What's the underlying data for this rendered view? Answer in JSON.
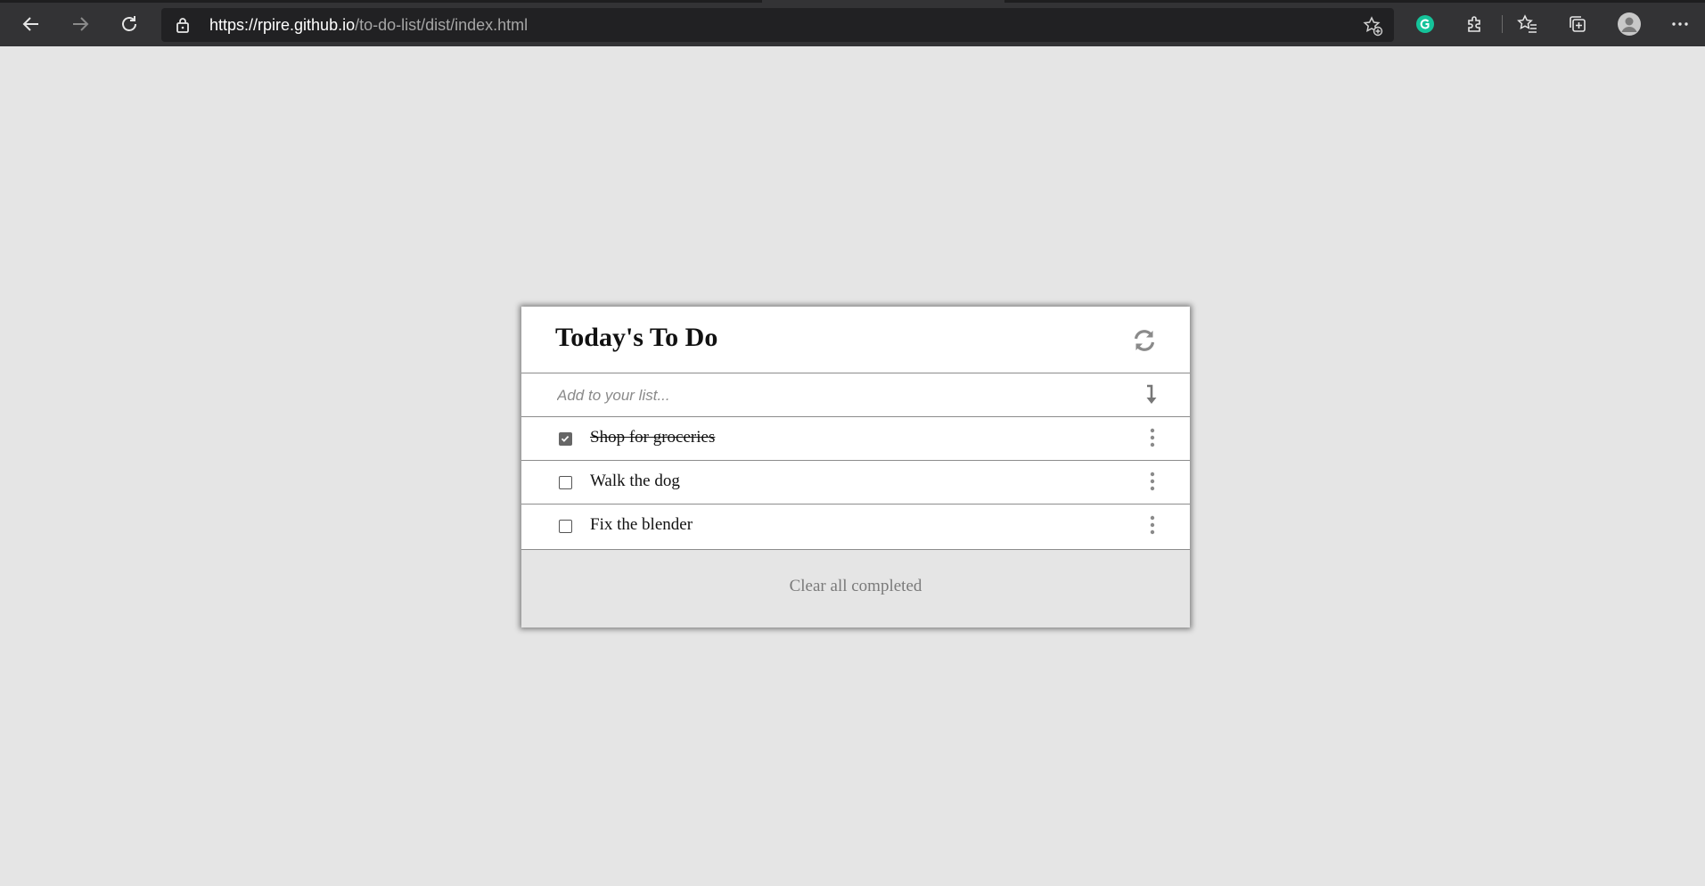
{
  "browser": {
    "url_host": "https://rpire.github.io",
    "url_path": "/to-do-list/dist/index.html"
  },
  "todo": {
    "title": "Today's To Do",
    "add_placeholder": "Add to your list...",
    "items": [
      {
        "label": "Shop for groceries",
        "completed": true
      },
      {
        "label": "Walk the dog",
        "completed": false
      },
      {
        "label": "Fix the blender",
        "completed": false
      }
    ],
    "clear_label": "Clear all completed"
  },
  "icons": {
    "back": "arrow-left-icon",
    "forward": "arrow-right-icon",
    "reload": "reload-icon",
    "lock": "lock-icon",
    "add_favorite": "star-plus-icon",
    "grammarly": "grammarly-icon",
    "extensions": "puzzle-icon",
    "favorites": "favorites-icon",
    "collections": "collections-icon",
    "profile": "profile-icon",
    "more": "more-icon",
    "refresh_list": "refresh-icon",
    "enter": "enter-icon",
    "item_menu": "vertical-dots-icon"
  },
  "colors": {
    "page_bg": "#e5e5e5",
    "chrome_bg": "#333335",
    "grammarly": "#15c39a"
  }
}
